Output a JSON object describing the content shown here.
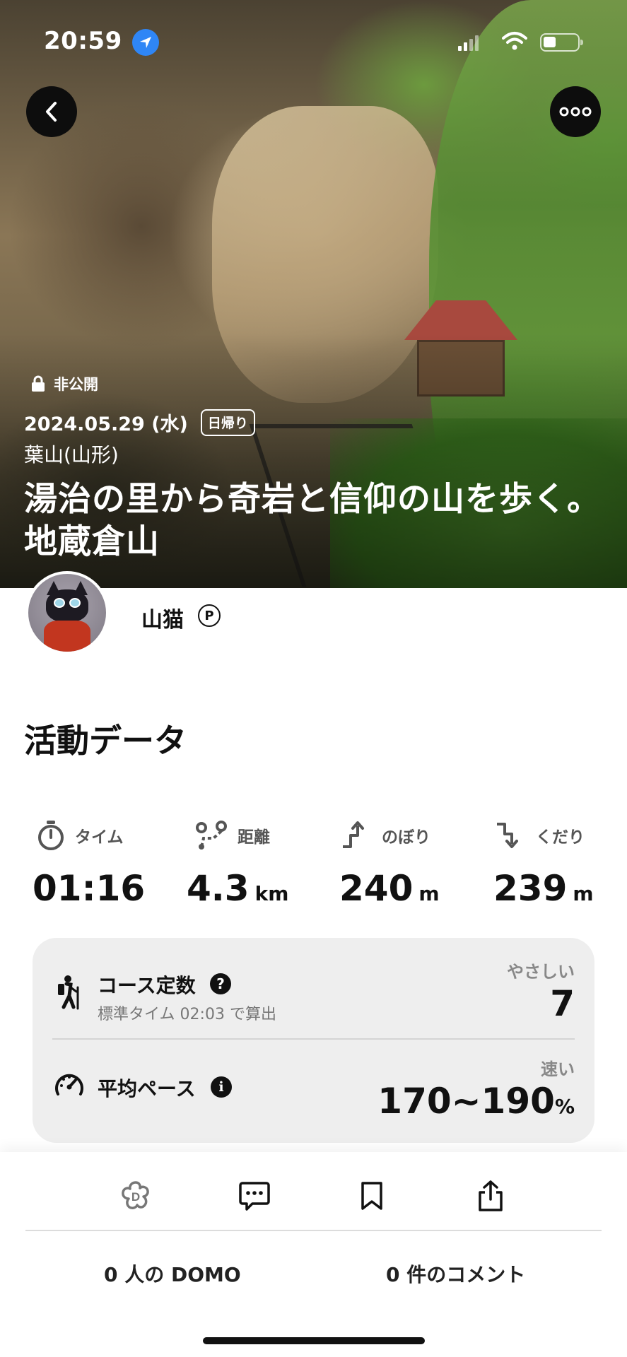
{
  "status_bar": {
    "time": "20:59"
  },
  "hero": {
    "privacy": "非公開",
    "date": "2024.05.29 (水)",
    "trip_type": "日帰り",
    "mountain": "葉山(山形)",
    "title": "湯治の里から奇岩と信仰の山を歩く。地蔵倉山"
  },
  "profile": {
    "name": "山猫",
    "premium_badge": "P"
  },
  "section_title": "活動データ",
  "stats": [
    {
      "label": "タイム",
      "value": "01:16",
      "unit": "",
      "icon": "stopwatch-icon"
    },
    {
      "label": "距離",
      "value": "4.3",
      "unit": "km",
      "icon": "route-icon"
    },
    {
      "label": "のぼり",
      "value": "240",
      "unit": "m",
      "icon": "ascent-icon"
    },
    {
      "label": "くだり",
      "value": "239",
      "unit": "m",
      "icon": "descent-icon"
    }
  ],
  "course": {
    "label": "コース定数",
    "help_glyph": "?",
    "subtitle": "標準タイム 02:03 で算出",
    "level": "やさしい",
    "value": "7"
  },
  "pace": {
    "label": "平均ペース",
    "info_glyph": "i",
    "level": "速い",
    "value": "170~190",
    "unit": "%"
  },
  "actions": {
    "domo_count": "0 人の DOMO",
    "comment_count": "0 件のコメント"
  },
  "colors": {
    "location_badge": "#2f86f6",
    "card_bg": "#eeeeee"
  }
}
